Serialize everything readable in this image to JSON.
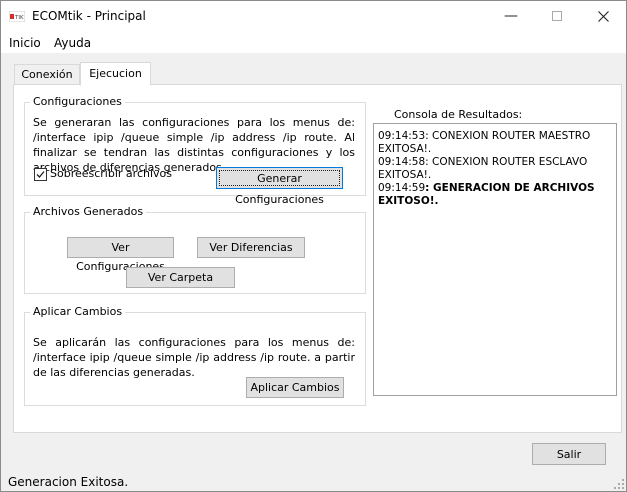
{
  "window": {
    "title": "ECOMtik - Principal",
    "icon_name": "ecomtik-app-icon"
  },
  "menu": {
    "items": [
      "Inicio",
      "Ayuda"
    ]
  },
  "tabs": [
    {
      "label": "Conexión"
    },
    {
      "label": "Ejecucion"
    }
  ],
  "configuraciones": {
    "title": "Configuraciones",
    "description": "Se generaran las configuraciones para los menus de: /interface ipip /queue simple /ip address /ip route. Al finalizar se tendran las distintas configuraciones y los archivos de diferencias generados.",
    "checkbox_label": "Sobreescribir archivos",
    "checkbox_checked": true,
    "generate_button": "Generar Configuraciones"
  },
  "archivos": {
    "title": "Archivos Generados",
    "ver_config_button": "Ver Configuraciones",
    "ver_diff_button": "Ver Diferencias",
    "ver_carpeta_button": "Ver Carpeta"
  },
  "aplicar": {
    "title": "Aplicar Cambios",
    "description": "Se aplicarán las configuraciones para los menus de: /interface ipip /queue simple /ip address /ip route. a partir de las diferencias generadas.",
    "apply_button": "Aplicar Cambios"
  },
  "console": {
    "label": "Consola de Resultados:",
    "lines": [
      {
        "time": "09:14:53",
        "text": ": CONEXION ROUTER MAESTRO EXITOSA!."
      },
      {
        "time": "09:14:58",
        "text": ": CONEXION ROUTER ESCLAVO EXITOSA!."
      },
      {
        "time": "09:14:59",
        "text": ": GENERACION DE ARCHIVOS EXITOSO!."
      }
    ]
  },
  "footer": {
    "exit_button": "Salir"
  },
  "status": {
    "text": "Generacion Exitosa."
  },
  "colors": {
    "accent": "#0078d7",
    "window_bg": "#f0f0f0",
    "panel_bg": "#ffffff"
  }
}
